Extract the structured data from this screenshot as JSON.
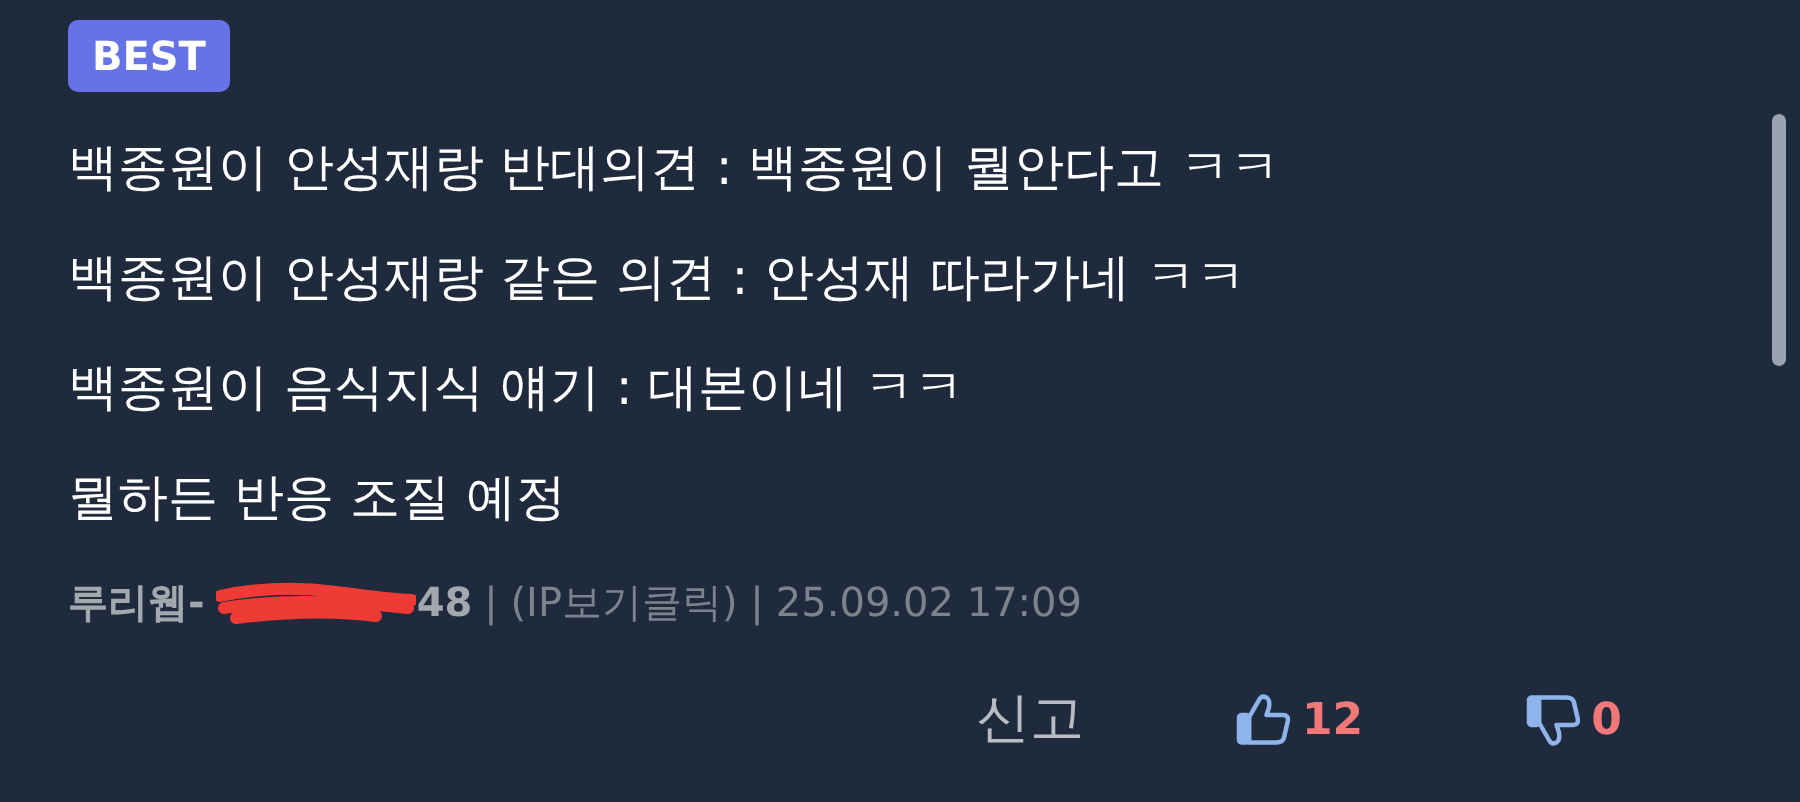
{
  "badge": "BEST",
  "lines": [
    "백종원이 안성재랑 반대의견 : 백종원이 뭘안다고 ㅋㅋ",
    "백종원이 안성재랑 같은 의견 : 안성재 따라가네 ㅋㅋ",
    "백종원이 음식지식 얘기 : 대본이네 ㅋㅋ",
    "뭘하든 반응 조질 예정"
  ],
  "meta": {
    "author_prefix": "루리웹-",
    "author_suffix": "48",
    "ip": "| (IP보기클릭) |",
    "date": "25.09.02 17:09"
  },
  "actions": {
    "report": "신고",
    "likes": "12",
    "dislikes": "0"
  }
}
